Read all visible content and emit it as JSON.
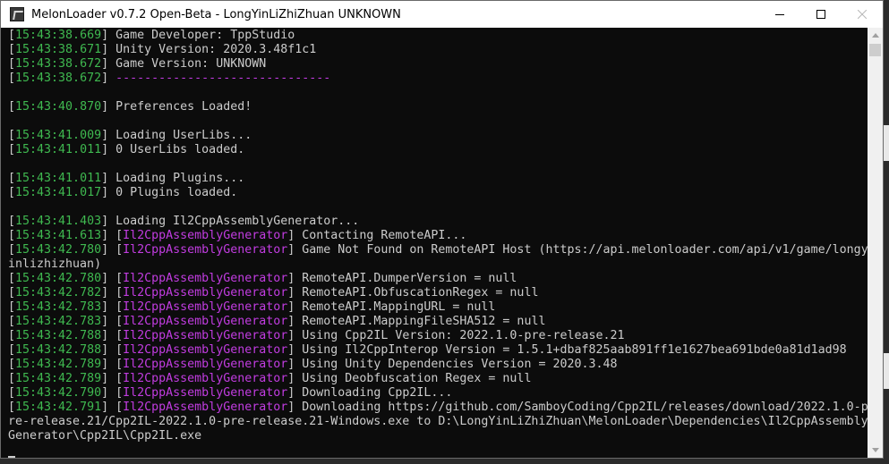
{
  "window": {
    "title": "MelonLoader v0.7.2 Open-Beta - LongYinLiZhiZhuan UNKNOWN"
  },
  "colors": {
    "timestamp": "#3fb950",
    "module": "#c13ce0",
    "text": "#cccccc",
    "background": "#0c0c0c"
  },
  "console": {
    "lines": [
      {
        "ts": "15:43:38.669",
        "mod": "",
        "msg": " Game Developer: TppStudio"
      },
      {
        "ts": "15:43:38.671",
        "mod": "",
        "msg": " Unity Version: 2020.3.48f1c1"
      },
      {
        "ts": "15:43:38.672",
        "mod": "",
        "msg": " Game Version: UNKNOWN"
      },
      {
        "ts": "15:43:38.672",
        "mod": "",
        "msg": "",
        "sep": " ------------------------------"
      },
      {
        "blank": true
      },
      {
        "ts": "15:43:40.870",
        "mod": "",
        "msg": " Preferences Loaded!"
      },
      {
        "blank": true
      },
      {
        "ts": "15:43:41.009",
        "mod": "",
        "msg": " Loading UserLibs..."
      },
      {
        "ts": "15:43:41.011",
        "mod": "",
        "msg": " 0 UserLibs loaded."
      },
      {
        "blank": true
      },
      {
        "ts": "15:43:41.011",
        "mod": "",
        "msg": " Loading Plugins..."
      },
      {
        "ts": "15:43:41.017",
        "mod": "",
        "msg": " 0 Plugins loaded."
      },
      {
        "blank": true
      },
      {
        "ts": "15:43:41.403",
        "mod": "",
        "msg": " Loading Il2CppAssemblyGenerator..."
      },
      {
        "ts": "15:43:41.613",
        "mod": "Il2CppAssemblyGenerator",
        "msg": " Contacting RemoteAPI..."
      },
      {
        "ts": "15:43:42.780",
        "mod": "Il2CppAssemblyGenerator",
        "msg": " Game Not Found on RemoteAPI Host (https://api.melonloader.com/api/v1/game/longy"
      },
      {
        "raw": "inlizhizhuan)"
      },
      {
        "ts": "15:43:42.780",
        "mod": "Il2CppAssemblyGenerator",
        "msg": " RemoteAPI.DumperVersion = null"
      },
      {
        "ts": "15:43:42.782",
        "mod": "Il2CppAssemblyGenerator",
        "msg": " RemoteAPI.ObfuscationRegex = null"
      },
      {
        "ts": "15:43:42.783",
        "mod": "Il2CppAssemblyGenerator",
        "msg": " RemoteAPI.MappingURL = null"
      },
      {
        "ts": "15:43:42.783",
        "mod": "Il2CppAssemblyGenerator",
        "msg": " RemoteAPI.MappingFileSHA512 = null"
      },
      {
        "ts": "15:43:42.788",
        "mod": "Il2CppAssemblyGenerator",
        "msg": " Using Cpp2IL Version: 2022.1.0-pre-release.21"
      },
      {
        "ts": "15:43:42.788",
        "mod": "Il2CppAssemblyGenerator",
        "msg": " Using Il2CppInterop Version = 1.5.1+dbaf825aab891ff1e1627bea691bde0a81d1ad98"
      },
      {
        "ts": "15:43:42.789",
        "mod": "Il2CppAssemblyGenerator",
        "msg": " Using Unity Dependencies Version = 2020.3.48"
      },
      {
        "ts": "15:43:42.789",
        "mod": "Il2CppAssemblyGenerator",
        "msg": " Using Deobfuscation Regex = null"
      },
      {
        "ts": "15:43:42.790",
        "mod": "Il2CppAssemblyGenerator",
        "msg": " Downloading Cpp2IL..."
      },
      {
        "ts": "15:43:42.791",
        "mod": "Il2CppAssemblyGenerator",
        "msg": " Downloading https://github.com/SamboyCoding/Cpp2IL/releases/download/2022.1.0-p"
      },
      {
        "raw": "re-release.21/Cpp2IL-2022.1.0-pre-release.21-Windows.exe to D:\\LongYinLiZhiZhuan\\MelonLoader\\Dependencies\\Il2CppAssembly"
      },
      {
        "raw": "Generator\\Cpp2IL\\Cpp2IL.exe"
      },
      {
        "cursor": true
      }
    ]
  }
}
